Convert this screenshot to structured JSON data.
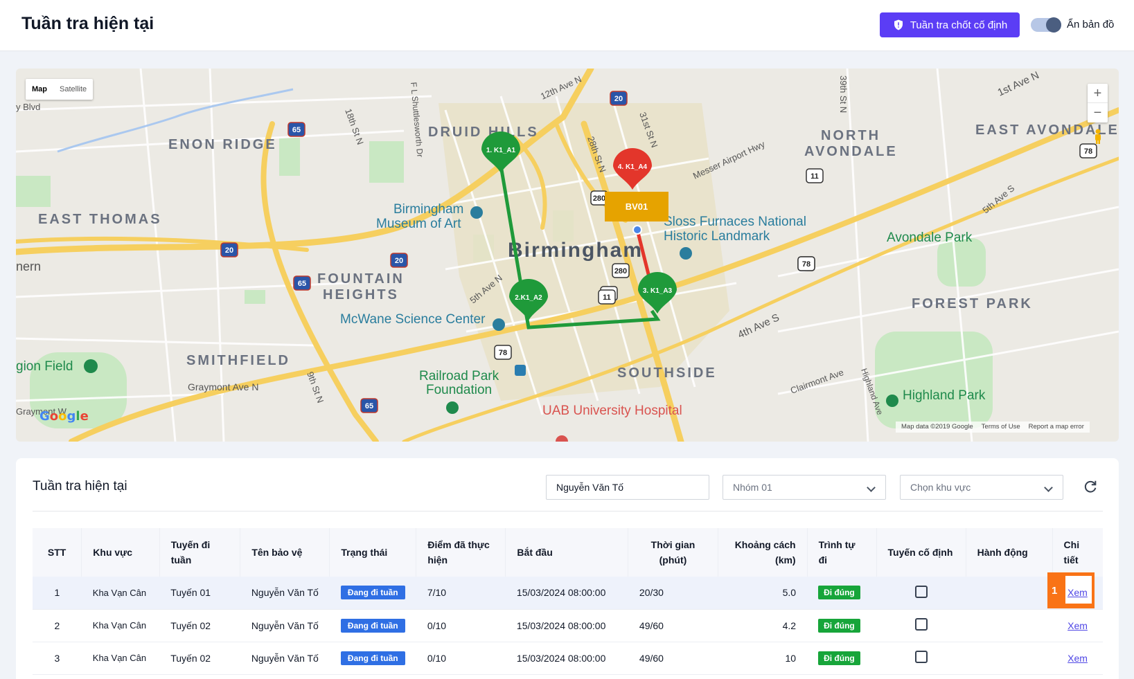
{
  "header": {
    "title": "Tuần tra hiện tại",
    "fixed_button": "Tuần tra chốt cố định",
    "toggle_label": "Ẩn bản đồ"
  },
  "map": {
    "type_map": "Map",
    "type_satellite": "Satellite",
    "zoom_in": "+",
    "zoom_out": "−",
    "labels": {
      "druid_hills": "DRUID HILLS",
      "enon_ridge": "ENON RIDGE",
      "north_avondale_1": "NORTH",
      "north_avondale_2": "AVONDALE",
      "east_avondale": "EAST AVONDALE",
      "east_thomas": "EAST THOMAS",
      "birmingham": "Birmingham",
      "museum_1": "Birmingham",
      "museum_2": "Museum of Art",
      "sloss_1": "Sloss Furnaces National",
      "sloss_2": "Historic Landmark",
      "avondale_park": "Avondale Park",
      "fountain_1": "FOUNTAIN",
      "fountain_2": "HEIGHTS",
      "forest_park": "FOREST PARK",
      "mcwane": "McWane Science Center",
      "smithfield": "SMITHFIELD",
      "graymont": "Graymont Ave N",
      "railroad_1": "Railroad Park",
      "railroad_2": "Foundation",
      "southside": "SOUTHSIDE",
      "uab": "UAB University Hospital",
      "highland": "Highland Park",
      "legion": "gion Field",
      "hern": "nern",
      "messer": "Messer Airport Hwy",
      "fourth_ave": "4th Ave S",
      "first_ave": "1st Ave N",
      "fifth_ave": "5th Ave S",
      "clairmont": "Clairmont Ave",
      "highland_ave": "Highland Ave",
      "twelfth": "12th Ave N",
      "eighteenth": "18th St N",
      "shuttlesworth": "F L Shuttlesworth Dr",
      "twentyeighth": "28th St N",
      "thirtyfirst": "31st St N",
      "thirtyninth": "39th St N",
      "fifth_ave_n": "5th Ave N",
      "ninth": "9th St N",
      "elvd": "y Blvd",
      "graymont_w": "Graymont W"
    },
    "shields": [
      "20",
      "65",
      "280",
      "11",
      "78",
      "20",
      "20",
      "65",
      "280",
      "11",
      "78",
      "65",
      "78",
      "11",
      "78"
    ],
    "pins": [
      {
        "label": "1. K1_A1",
        "color": "#1f9a3a"
      },
      {
        "label": "2.K1_A2",
        "color": "#1f9a3a"
      },
      {
        "label": "3. K1_A3",
        "color": "#1f9a3a"
      },
      {
        "label": "4. K1_A4",
        "color": "#e3362b"
      }
    ],
    "guard_label": "BV01",
    "google": "Google",
    "attribution": [
      "Map data ©2019 Google",
      "Terms of Use",
      "Report a map error"
    ]
  },
  "panel": {
    "title": "Tuần tra hiện tại",
    "guard_input": "Nguyễn Văn Tố",
    "group_select": "Nhóm 01",
    "area_select": "Chọn khu vực"
  },
  "table": {
    "headers": [
      "STT",
      "Khu vực",
      "Tuyến đi tuần",
      "Tên bảo vệ",
      "Trạng thái",
      "Điểm đã thực hiện",
      "Bắt đầu",
      "Thời gian (phút)",
      "Khoảng cách (km)",
      "Trình tự đi",
      "Tuyến cố định",
      "Hành động",
      "Chi tiết"
    ],
    "rows": [
      {
        "stt": "1",
        "area": "Kha Vạn Cân",
        "route": "Tuyến 01",
        "guard": "Nguyễn Văn Tố",
        "status": "Đang đi tuần",
        "points": "7/10",
        "start": "15/03/2024 08:00:00",
        "time": "20/30",
        "distance": "5.0",
        "order": "Đi đúng",
        "detail": "Xem"
      },
      {
        "stt": "2",
        "area": "Kha Vạn Cân",
        "route": "Tuyến 02",
        "guard": "Nguyễn Văn Tố",
        "status": "Đang đi tuần",
        "points": "0/10",
        "start": "15/03/2024 08:00:00",
        "time": "49/60",
        "distance": "4.2",
        "order": "Đi đúng",
        "detail": "Xem"
      },
      {
        "stt": "3",
        "area": "Kha Vạn Cân",
        "route": "Tuyến 02",
        "guard": "Nguyễn Văn Tố",
        "status": "Đang đi tuần",
        "points": "0/10",
        "start": "15/03/2024 08:00:00",
        "time": "49/60",
        "distance": "10",
        "order": "Đi đúng",
        "detail": "Xem"
      }
    ]
  },
  "annotation": {
    "number": "1"
  },
  "colors": {
    "accent": "#5b3df5",
    "status_blue": "#2f6fe4",
    "ok_green": "#17a53a",
    "annotation": "#f97316"
  }
}
